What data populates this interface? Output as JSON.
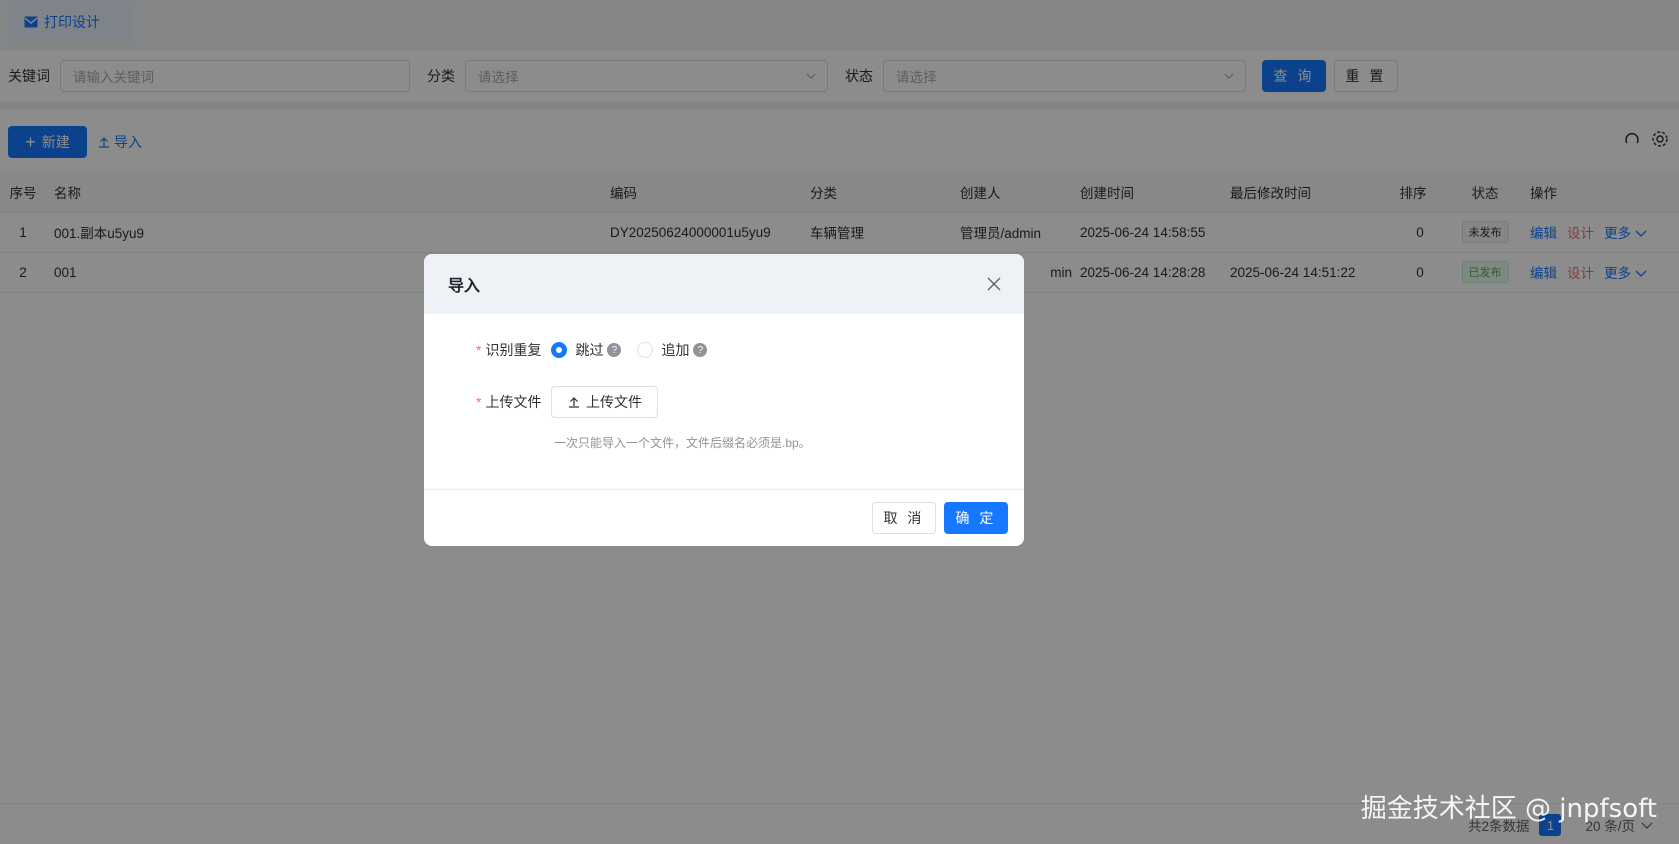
{
  "tab": {
    "label": "打印设计"
  },
  "search": {
    "keyword_label": "关键词",
    "keyword_placeholder": "请输入关键词",
    "category_label": "分类",
    "category_placeholder": "请选择",
    "status_label": "状态",
    "status_placeholder": "请选择",
    "query_label": "查 询",
    "reset_label": "重 置"
  },
  "toolbar": {
    "new_label": "新建",
    "import_label": "导入"
  },
  "table": {
    "headers": [
      "序号",
      "名称",
      "编码",
      "分类",
      "创建人",
      "创建时间",
      "最后修改时间",
      "排序",
      "状态",
      "操作"
    ],
    "rows": [
      {
        "idx": "1",
        "name": "001.副本u5yu9",
        "code": "DY20250624000001u5yu9",
        "category": "车辆管理",
        "creator": "管理员/admin",
        "created": "2025-06-24 14:58:55",
        "modified": "",
        "sort": "0",
        "status": "未发布",
        "edit": "编辑",
        "design": "设计",
        "more": "更多"
      },
      {
        "idx": "2",
        "name": "001",
        "code": "",
        "category": "",
        "creator": "min",
        "created": "2025-06-24 14:28:28",
        "modified": "2025-06-24 14:51:22",
        "sort": "0",
        "status": "已发布",
        "edit": "编辑",
        "design": "设计",
        "more": "更多"
      }
    ]
  },
  "footer": {
    "total": "共2条数据",
    "page": "1",
    "page_size": "20 条/页"
  },
  "modal": {
    "title": "导入",
    "dup_label": "识别重复",
    "opt_skip": "跳过",
    "opt_append": "追加",
    "file_label": "上传文件",
    "upload_button": "上传文件",
    "hint": "一次只能导入一个文件，文件后缀名必须是.bp。",
    "cancel": "取 消",
    "confirm": "确 定"
  },
  "watermark": "掘金技术社区 @ jnpfsoft",
  "colors": {
    "primary": "#1677ff",
    "danger": "#f56c6c",
    "success": "#4caf50"
  }
}
